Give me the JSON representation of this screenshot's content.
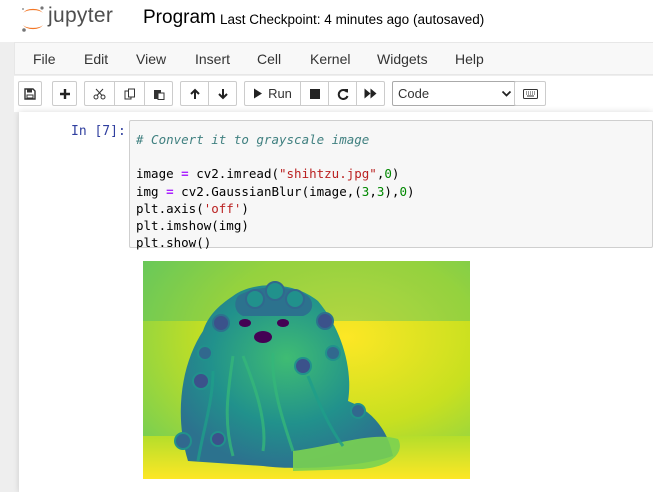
{
  "header": {
    "logo_text": "jupyter",
    "notebook_title": "Program",
    "checkpoint": "Last Checkpoint: 4 minutes ago",
    "autosave_status": "(autosaved)"
  },
  "menu": [
    "File",
    "Edit",
    "View",
    "Insert",
    "Cell",
    "Kernel",
    "Widgets",
    "Help"
  ],
  "toolbar": {
    "run_label": "Run",
    "cell_type": "Code",
    "icons": [
      "save-icon",
      "plus-icon",
      "scissors-icon",
      "copy-icon",
      "paste-icon",
      "arrow-up-icon",
      "arrow-down-icon",
      "play-icon",
      "stop-icon",
      "restart-icon",
      "fast-forward-icon",
      "keyboard-icon"
    ]
  },
  "cell": {
    "prompt": "In [7]:",
    "code": [
      "# Convert it to grayscale image",
      "",
      "image = cv2.imread(\"shihtzu.jpg\",0)",
      "img = cv2.GaussianBlur(image,(3,3),0)",
      "plt.axis('off')",
      "plt.imshow(img)",
      "plt.show()"
    ]
  },
  "colors": {
    "prompt_blue": "#303f9f",
    "logo_orange": "#f37726",
    "viridis_yellow": "#d9e021",
    "viridis_green": "#2fb47c",
    "viridis_teal": "#21918c",
    "viridis_purple": "#440154"
  },
  "output": {
    "image_description_icon": "dog-image-viridis"
  }
}
